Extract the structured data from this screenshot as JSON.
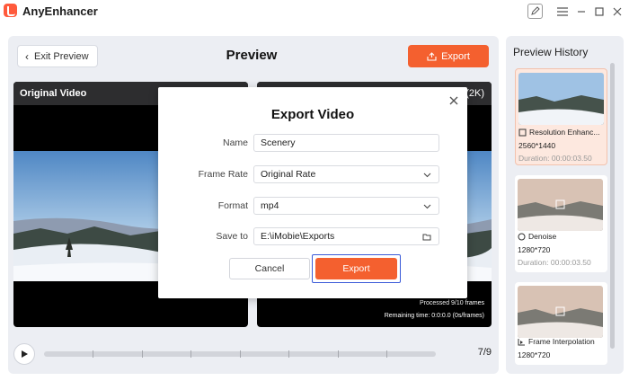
{
  "app": {
    "title": "AnyEnhancer"
  },
  "titlebar": {
    "icons": [
      "feedback-icon",
      "menu-icon",
      "minimize-icon",
      "maximize-icon",
      "close-icon"
    ]
  },
  "toolbar": {
    "exit_label": "Exit Preview",
    "page_title": "Preview",
    "export_label": "Export"
  },
  "video": {
    "original_label": "Original Video",
    "enhanced_suffix": "(2K)",
    "processed_text": "Processed 9/10 frames",
    "remaining_text": "Remaining time: 0:0:0.0 (0s/frames)"
  },
  "playback": {
    "frame_counter": "7/9"
  },
  "history": {
    "title": "Preview History",
    "items": [
      {
        "label": "Resolution Enhanc...",
        "resolution": "2560*1440",
        "duration": "Duration: 00:00:03.50",
        "icon": "resolution-icon",
        "active": true
      },
      {
        "label": "Denoise",
        "resolution": "1280*720",
        "duration": "Duration: 00:00:03.50",
        "icon": "denoise-icon",
        "active": false
      },
      {
        "label": "Frame Interpolation",
        "resolution": "1280*720",
        "duration": "",
        "icon": "frame-interpolation-icon",
        "active": false
      }
    ]
  },
  "dialog": {
    "title": "Export Video",
    "name_label": "Name",
    "name_value": "Scenery",
    "frame_rate_label": "Frame Rate",
    "frame_rate_value": "Original Rate",
    "format_label": "Format",
    "format_value": "mp4",
    "save_label": "Save to",
    "save_value": "E:\\iMobie\\Exports",
    "cancel_label": "Cancel",
    "export_label": "Export"
  },
  "colors": {
    "accent": "#f4602f",
    "focus": "#3b5bd8",
    "panel": "#eceef3"
  }
}
